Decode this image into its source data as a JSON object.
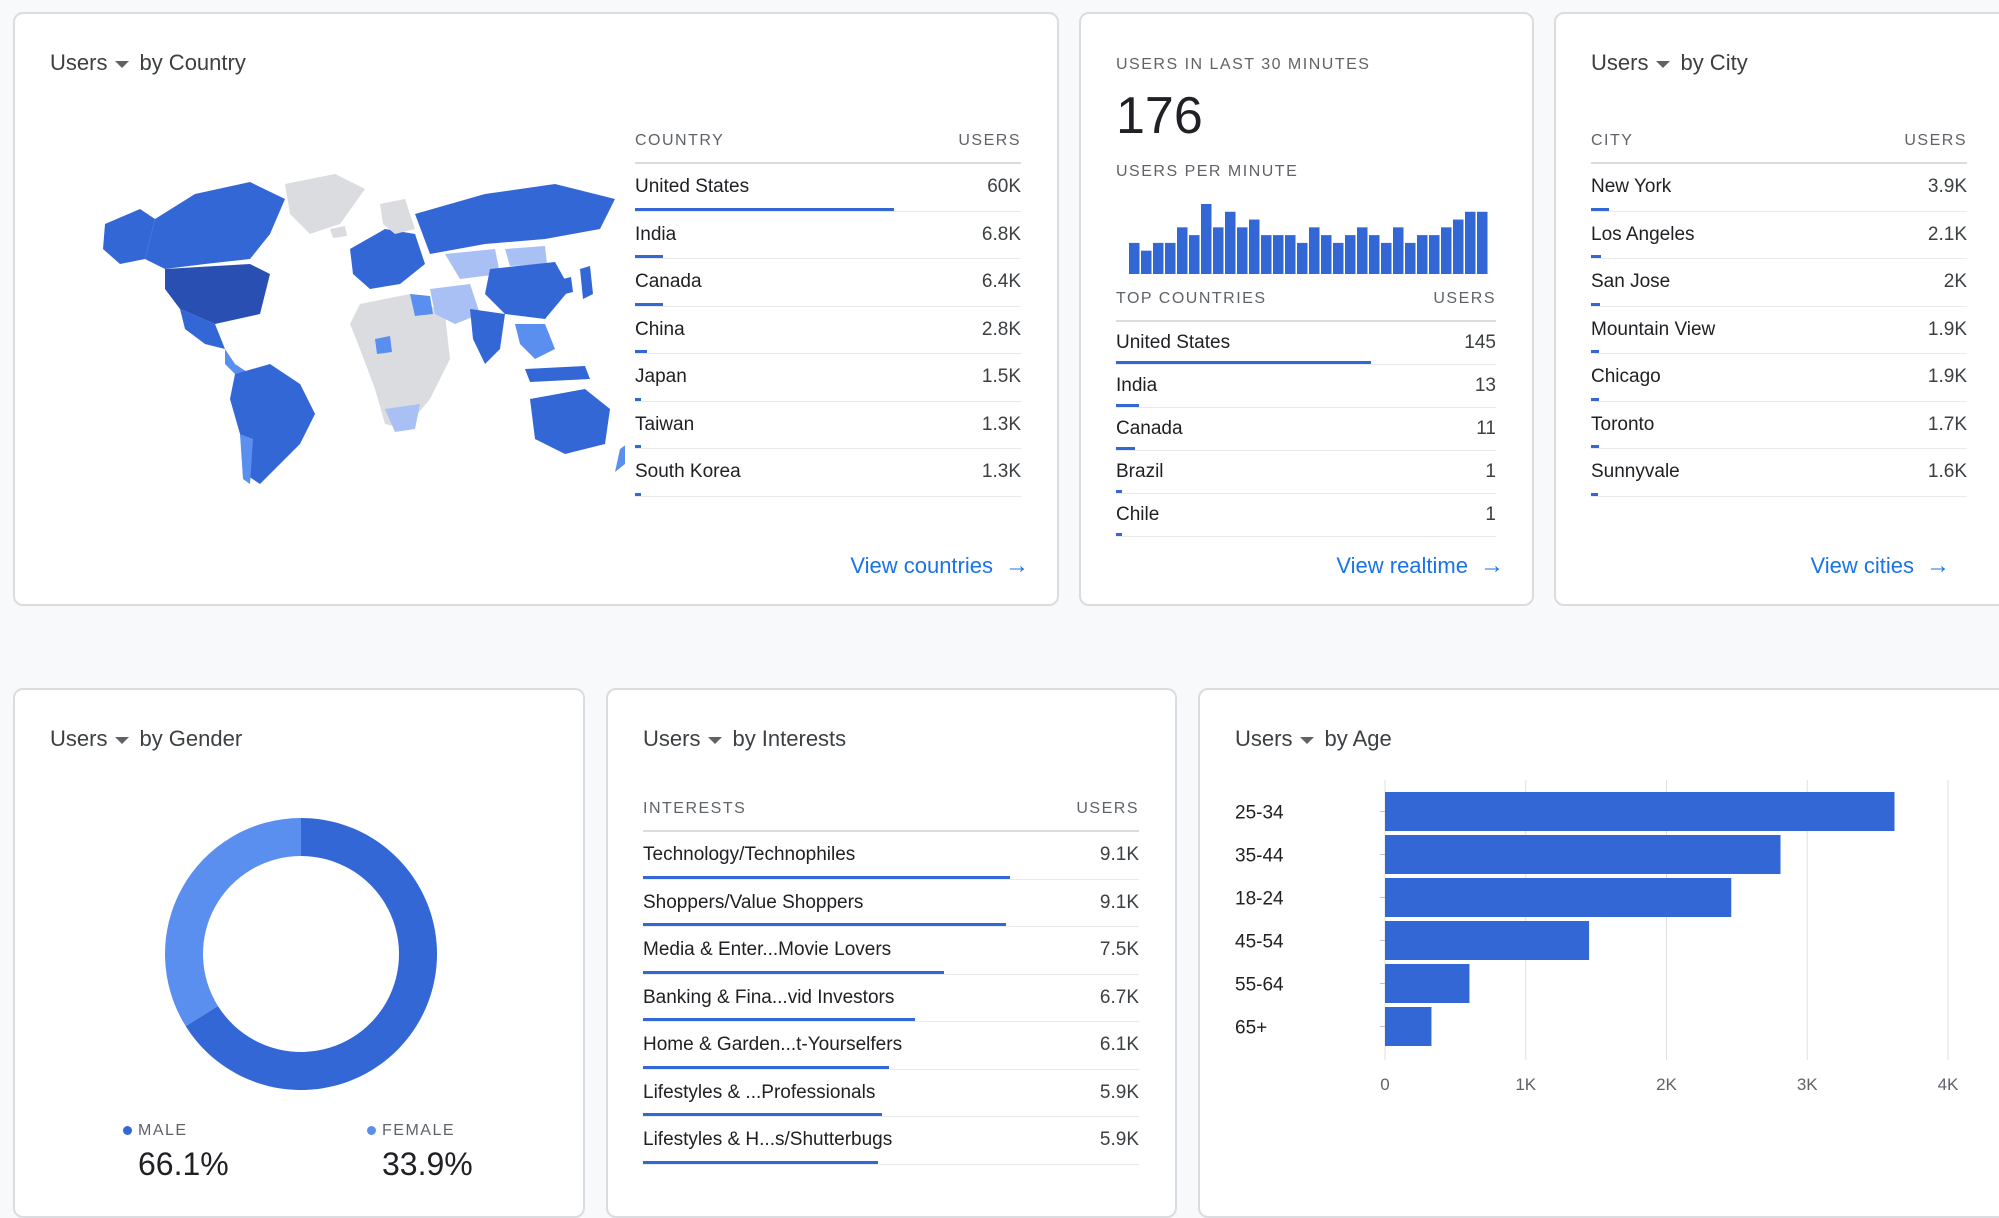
{
  "colors": {
    "primary": "#3367d6",
    "secondary": "#5a8ff0",
    "dark": "#2a4fb3",
    "light": "#a8c0f3",
    "gray": "#dadce0",
    "link": "#1a73e8"
  },
  "country_card": {
    "metric": "Users",
    "by": "by Country",
    "col_name": "COUNTRY",
    "col_value": "USERS",
    "rows": [
      {
        "name": "United States",
        "value": "60K",
        "fraction": 1.0
      },
      {
        "name": "India",
        "value": "6.8K",
        "fraction": 0.11
      },
      {
        "name": "Canada",
        "value": "6.4K",
        "fraction": 0.107
      },
      {
        "name": "China",
        "value": "2.8K",
        "fraction": 0.047
      },
      {
        "name": "Japan",
        "value": "1.5K",
        "fraction": 0.025
      },
      {
        "name": "Taiwan",
        "value": "1.3K",
        "fraction": 0.022
      },
      {
        "name": "South Korea",
        "value": "1.3K",
        "fraction": 0.022
      }
    ],
    "link": "View countries"
  },
  "realtime_card": {
    "label": "USERS IN LAST 30 MINUTES",
    "count": "176",
    "per_minute_label": "USERS PER MINUTE",
    "per_minute": [
      4,
      3,
      4,
      4,
      6,
      5,
      9,
      6,
      8,
      6,
      7,
      5,
      5,
      5,
      4,
      6,
      5,
      4,
      5,
      6,
      5,
      4,
      6,
      4,
      5,
      5,
      6,
      7,
      8,
      8
    ],
    "col_name": "TOP COUNTRIES",
    "col_value": "USERS",
    "rows": [
      {
        "name": "United States",
        "value": "145",
        "fraction": 1.0
      },
      {
        "name": "India",
        "value": "13",
        "fraction": 0.09
      },
      {
        "name": "Canada",
        "value": "11",
        "fraction": 0.076
      },
      {
        "name": "Brazil",
        "value": "1",
        "fraction": 0.007
      },
      {
        "name": "Chile",
        "value": "1",
        "fraction": 0.007
      }
    ],
    "link": "View realtime"
  },
  "city_card": {
    "metric": "Users",
    "by": "by City",
    "col_name": "CITY",
    "col_value": "USERS",
    "rows": [
      {
        "name": "New York",
        "value": "3.9K",
        "fraction": 0.07
      },
      {
        "name": "Los Angeles",
        "value": "2.1K",
        "fraction": 0.04
      },
      {
        "name": "San Jose",
        "value": "2K",
        "fraction": 0.035
      },
      {
        "name": "Mountain View",
        "value": "1.9K",
        "fraction": 0.033
      },
      {
        "name": "Chicago",
        "value": "1.9K",
        "fraction": 0.033
      },
      {
        "name": "Toronto",
        "value": "1.7K",
        "fraction": 0.03
      },
      {
        "name": "Sunnyvale",
        "value": "1.6K",
        "fraction": 0.028
      }
    ],
    "link": "View cities"
  },
  "gender_card": {
    "metric": "Users",
    "by": "by Gender",
    "male_label": "MALE",
    "male_value": "66.1%",
    "male_fraction": 0.661,
    "female_label": "FEMALE",
    "female_value": "33.9%",
    "female_fraction": 0.339
  },
  "interests_card": {
    "metric": "Users",
    "by": "by Interests",
    "col_name": "INTERESTS",
    "col_value": "USERS",
    "rows": [
      {
        "name": "Technology/Technophiles",
        "value": "9.1K",
        "fraction": 1.0
      },
      {
        "name": "Shoppers/Value Shoppers",
        "value": "9.1K",
        "fraction": 0.99
      },
      {
        "name": "Media & Enter...Movie Lovers",
        "value": "7.5K",
        "fraction": 0.82
      },
      {
        "name": "Banking & Fina...vid Investors",
        "value": "6.7K",
        "fraction": 0.74
      },
      {
        "name": "Home & Garden...t-Yourselfers",
        "value": "6.1K",
        "fraction": 0.67
      },
      {
        "name": "Lifestyles & ...Professionals",
        "value": "5.9K",
        "fraction": 0.65
      },
      {
        "name": "Lifestyles & H...s/Shutterbugs",
        "value": "5.9K",
        "fraction": 0.64
      }
    ]
  },
  "age_card": {
    "metric": "Users",
    "by": "by Age"
  },
  "chart_data": {
    "type": "bar",
    "orientation": "horizontal",
    "categories": [
      "25-34",
      "35-44",
      "18-24",
      "45-54",
      "55-64",
      "65+"
    ],
    "values": [
      3620,
      2810,
      2460,
      1450,
      600,
      330
    ],
    "xlim": [
      0,
      4000
    ],
    "xticks": [
      "0",
      "1K",
      "2K",
      "3K",
      "4K"
    ],
    "grid": true
  }
}
